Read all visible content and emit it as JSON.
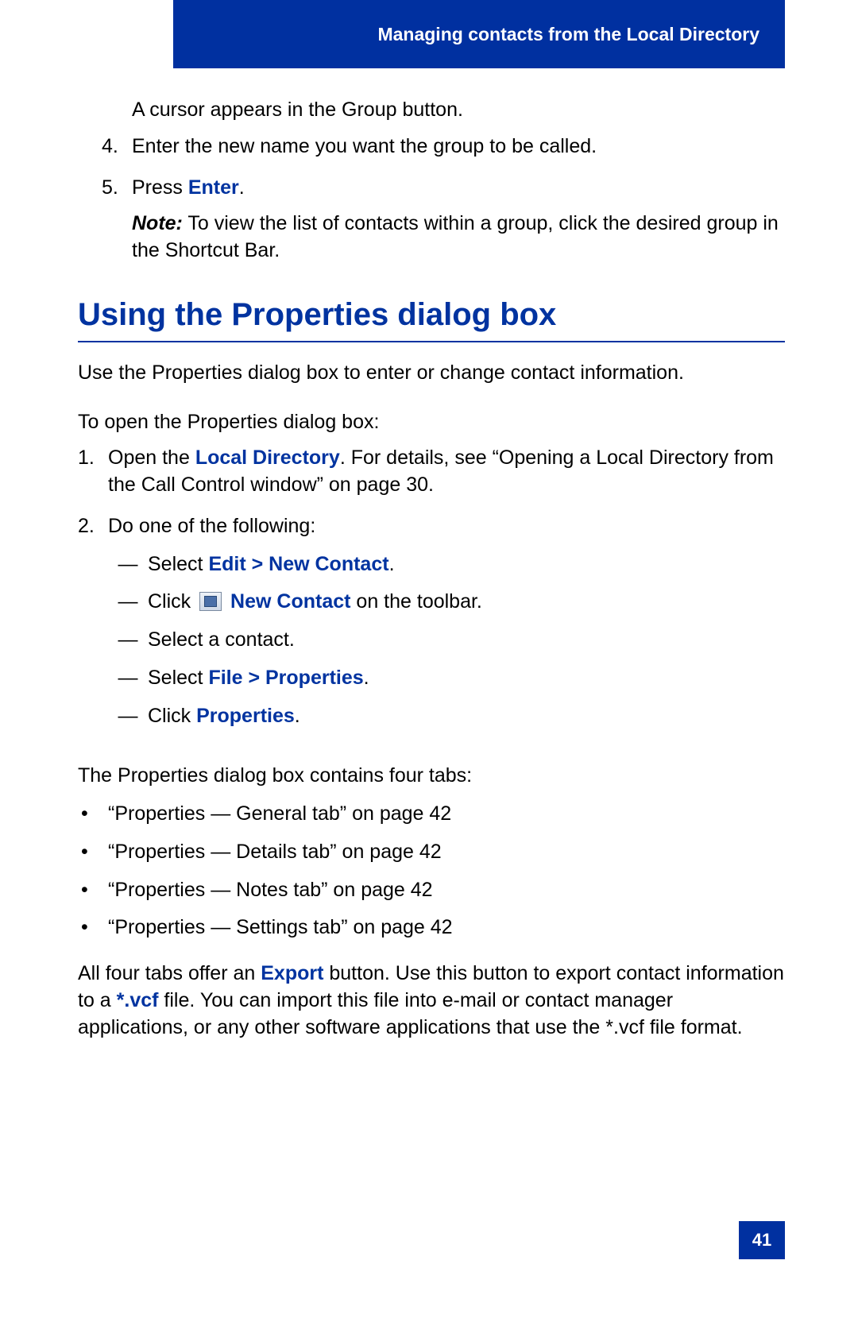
{
  "header": {
    "title": "Managing contacts from the Local Directory"
  },
  "intro_line": "A cursor appears in the Group button.",
  "steps_upper": [
    {
      "num": "4.",
      "text_before": "Enter the new name you want the group to be called."
    },
    {
      "num": "5.",
      "press_label": "Press ",
      "enter_label": "Enter",
      "period": "."
    }
  ],
  "note": {
    "label": "Note:",
    "text": " To view the list of contacts within a group, click the desired group in the Shortcut Bar."
  },
  "section_heading": "Using the Properties dialog box",
  "lead_para": "Use the Properties dialog box to enter or change contact information.",
  "open_intro": "To open the Properties dialog box:",
  "open_steps": {
    "s1": {
      "num": "1.",
      "pre": "Open the ",
      "link": "Local Directory",
      "post": ". For details, see “Opening a Local Directory from the Call Control window” on page 30."
    },
    "s2": {
      "num": "2.",
      "text": "Do one of the following:"
    }
  },
  "options": {
    "o1": {
      "pre": "Select ",
      "link": "Edit > New Contact",
      "post": "."
    },
    "o2": {
      "pre": "Click ",
      "link": " New Contact",
      "post": " on the toolbar."
    },
    "o3": {
      "text": "Select a contact."
    },
    "o4": {
      "pre": "Select ",
      "link": "File > Properties",
      "post": "."
    },
    "o5": {
      "pre": "Click ",
      "link": "Properties",
      "post": "."
    }
  },
  "tabs_intro": "The Properties dialog box contains four tabs:",
  "tabs": [
    "“Properties — General tab” on page 42",
    "“Properties — Details tab” on page 42",
    "“Properties — Notes tab” on page 42",
    "“Properties — Settings tab” on page 42"
  ],
  "export_para": {
    "p1": "All four tabs offer an ",
    "link1": "Export",
    "p2": " button. Use this button to export contact information to a ",
    "link2": "*.vcf",
    "p3": " file. You can import this file into e-mail or contact manager applications, or any other software applications that use the *.vcf file format."
  },
  "page_number": "41",
  "glyphs": {
    "dash": "—",
    "bullet": "•"
  }
}
